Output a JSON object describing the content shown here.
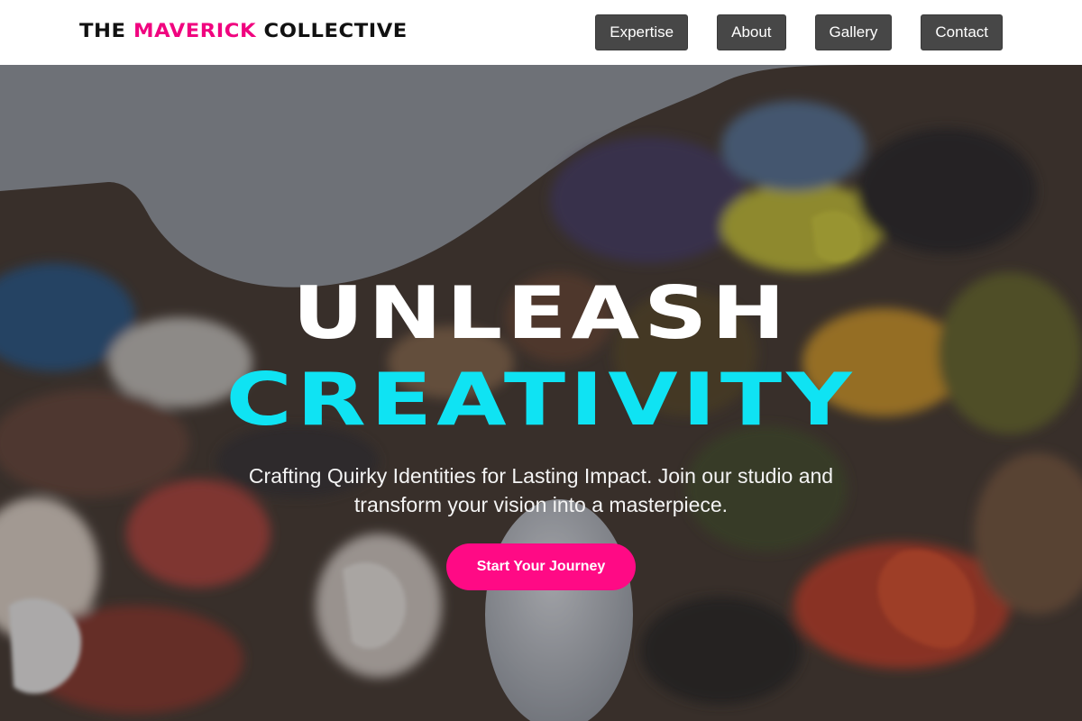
{
  "brand": {
    "prefix": "THE ",
    "accent": "MAVERICK",
    "suffix": " COLLECTIVE",
    "accent_color": "#f0047f"
  },
  "nav": {
    "items": [
      {
        "label": "Expertise"
      },
      {
        "label": "About"
      },
      {
        "label": "Gallery"
      },
      {
        "label": "Contact"
      }
    ]
  },
  "hero": {
    "headline_line1": "UNLEASH",
    "headline_line2": "CREATIVITY",
    "headline_line2_color": "#0fe3f3",
    "subtitle": "Crafting Quirky Identities for Lasting Impact. Join our studio and transform your vision into a masterpiece.",
    "cta_label": "Start Your Journey",
    "cta_color": "#ff0a85",
    "background": "paint-palette-photo"
  }
}
